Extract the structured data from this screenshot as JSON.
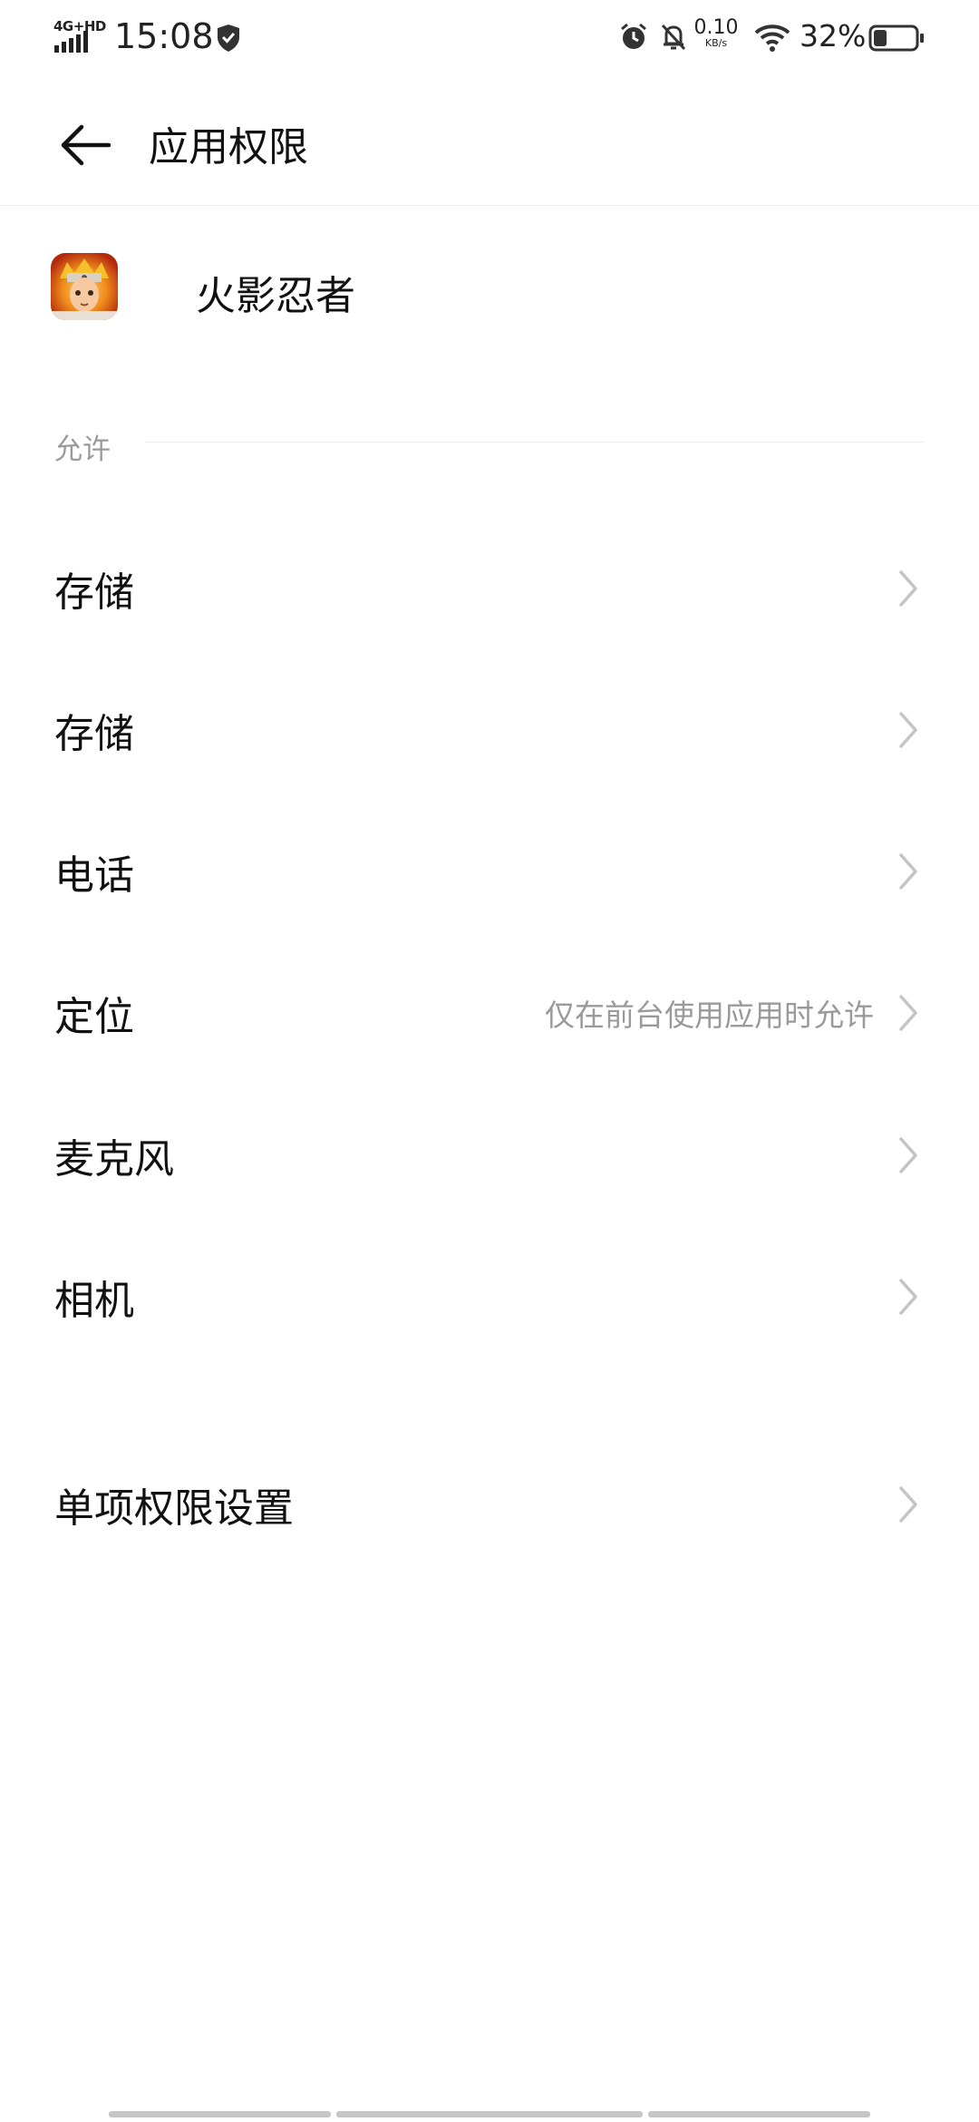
{
  "status_bar": {
    "network": "4G+HD",
    "time": "15:08",
    "speed_value": "0.10",
    "speed_unit": "KB/s",
    "battery_percent": "32%",
    "battery_level": 0.32,
    "icons": [
      "signal-icon",
      "shield-icon",
      "alarm-icon",
      "bell-off-icon",
      "wifi-icon",
      "battery-icon"
    ]
  },
  "header": {
    "title": "应用权限",
    "back_icon": "arrow-left-icon"
  },
  "app": {
    "name": "火影忍者",
    "icon": "app-icon"
  },
  "section": {
    "label": "允许"
  },
  "permissions": [
    {
      "label": "存储",
      "value": ""
    },
    {
      "label": "存储",
      "value": ""
    },
    {
      "label": "电话",
      "value": ""
    },
    {
      "label": "定位",
      "value": "仅在前台使用应用时允许"
    },
    {
      "label": "麦克风",
      "value": ""
    },
    {
      "label": "相机",
      "value": ""
    }
  ],
  "individual_settings": {
    "label": "单项权限设置"
  },
  "colors": {
    "background": "#ffffff",
    "primary_text": "#111111",
    "secondary_text": "#9a9a9a",
    "chevron": "#c4c4c4"
  }
}
